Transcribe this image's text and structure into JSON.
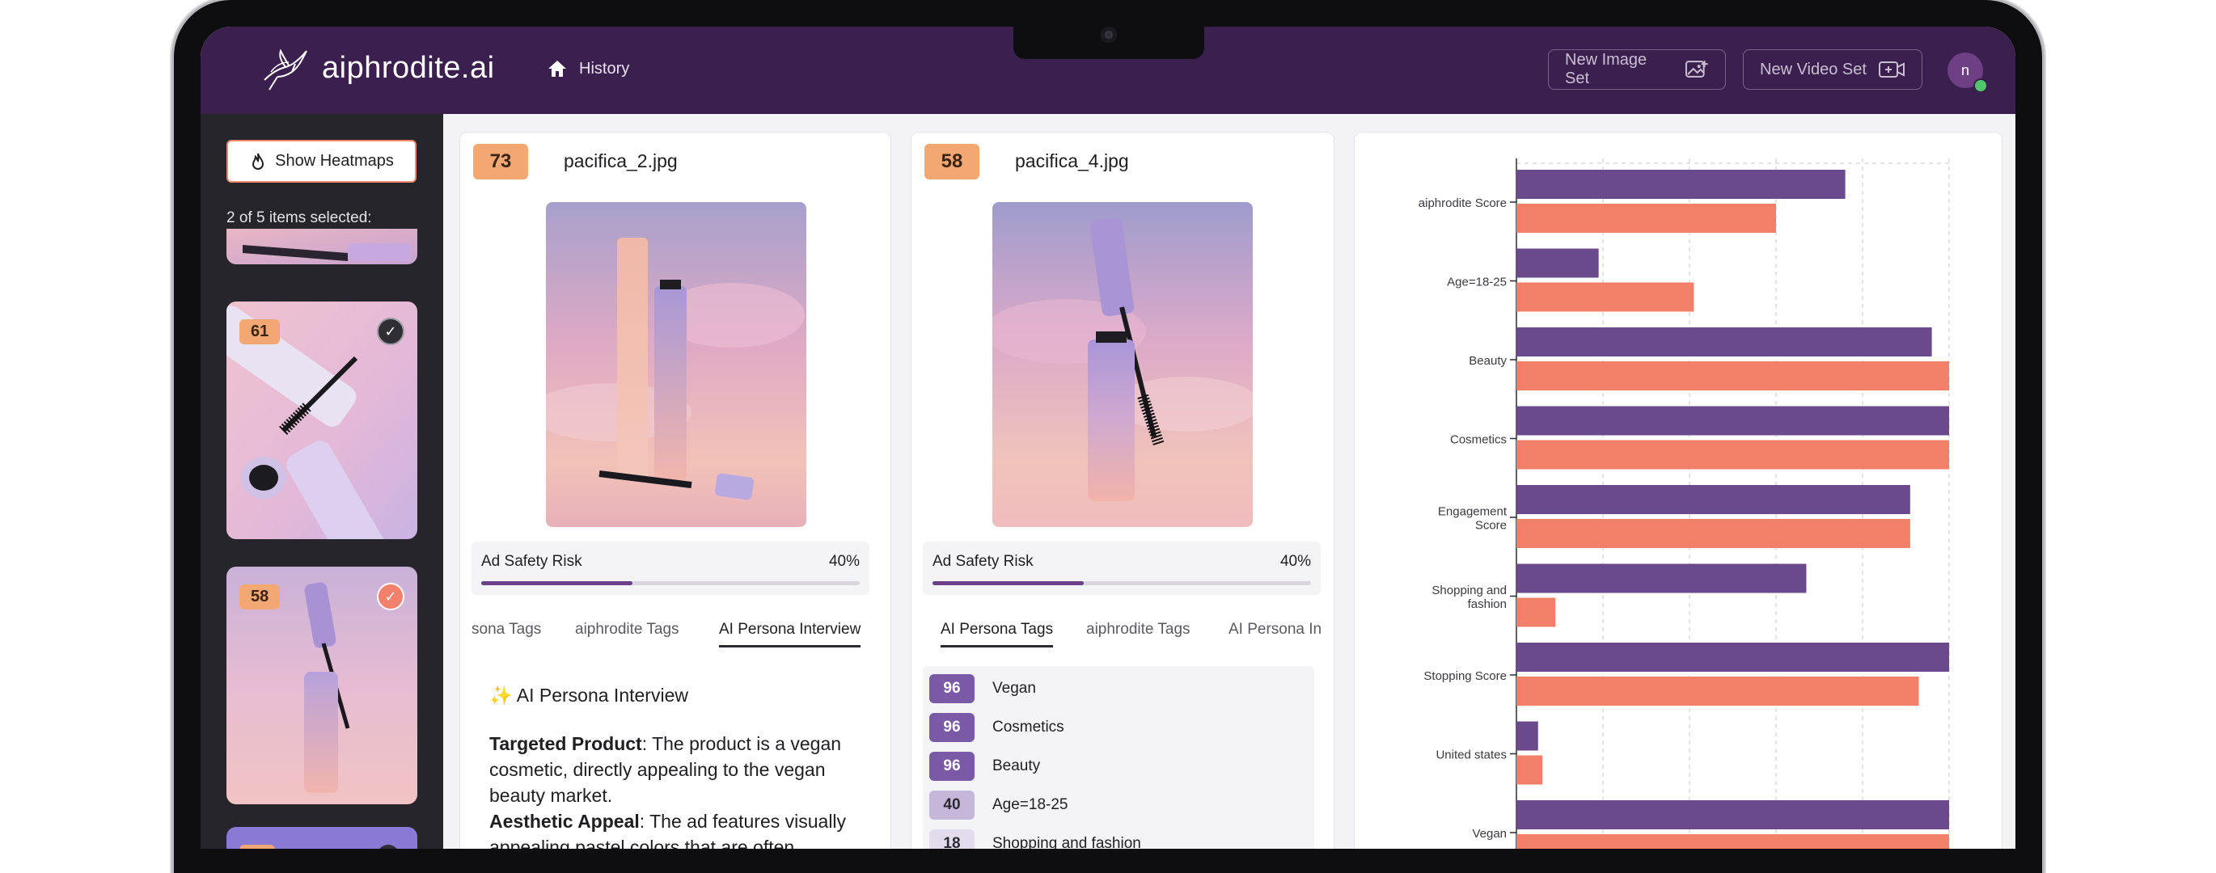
{
  "header": {
    "brand": "aiphrodite.ai",
    "nav_history": "History",
    "new_image_set": "New Image Set",
    "new_video_set": "New Video Set",
    "avatar_initial": "n"
  },
  "sidebar": {
    "heatmaps_button": "Show Heatmaps",
    "selected_count": "2 of 5 items selected:",
    "thumbnails": [
      {
        "score": "",
        "selected": false
      },
      {
        "score": "61",
        "selected": false
      },
      {
        "score": "58",
        "selected": true
      },
      {
        "score": "",
        "selected": false
      }
    ]
  },
  "cards": [
    {
      "score": "73",
      "filename": "pacifica_2.jpg",
      "ad_safety_label": "Ad Safety Risk",
      "ad_safety_value": "40%",
      "ad_safety_fraction": 0.4,
      "tabs": [
        "sona Tags",
        "aiphrodite Tags",
        "AI Persona Interview"
      ],
      "active_tab": 2,
      "interview": {
        "heading": "✨ AI Persona Interview",
        "p1_label": "Targeted Product",
        "p1_text": ": The product is a vegan cosmetic, directly appealing to the vegan beauty market.",
        "p2_label": "Aesthetic Appeal",
        "p2_text": ": The ad features visually appealing pastel colors that are often popular"
      }
    },
    {
      "score": "58",
      "filename": "pacifica_4.jpg",
      "ad_safety_label": "Ad Safety Risk",
      "ad_safety_value": "40%",
      "ad_safety_fraction": 0.4,
      "tabs": [
        "AI Persona Tags",
        "aiphrodite Tags",
        "AI Persona In"
      ],
      "active_tab": 0,
      "tags": [
        {
          "value": "96",
          "label": "Vegan"
        },
        {
          "value": "96",
          "label": "Cosmetics"
        },
        {
          "value": "96",
          "label": "Beauty"
        },
        {
          "value": "40",
          "label": "Age=18-25"
        },
        {
          "value": "18",
          "label": "Shopping and fashion"
        }
      ]
    }
  ],
  "colors": {
    "purple": "#6a4a8c",
    "coral": "#f28069",
    "score_badge": "#f3a873",
    "header": "#3b1f4f"
  },
  "chart_data": {
    "type": "bar",
    "orientation": "horizontal",
    "categories": [
      "aiphrodite Score",
      "Age=18-25",
      "Beauty",
      "Cosmetics",
      "Engagement Score",
      "Shopping and fashion",
      "Stopping Score",
      "United states",
      "Vegan"
    ],
    "category_lines": [
      [
        "aiphrodite Score"
      ],
      [
        "Age=18-25"
      ],
      [
        "Beauty"
      ],
      [
        "Cosmetics"
      ],
      [
        "Engagement",
        "Score"
      ],
      [
        "Shopping and",
        "fashion"
      ],
      [
        "Stopping Score"
      ],
      [
        "United states"
      ],
      [
        "Vegan"
      ]
    ],
    "series": [
      {
        "values": [
          76,
          19,
          96,
          100,
          91,
          67,
          100,
          5,
          100
        ],
        "color": "#6a4a8c"
      },
      {
        "values": [
          60,
          41,
          100,
          100,
          91,
          9,
          93,
          6,
          100
        ],
        "color": "#f28069"
      }
    ],
    "xlim": [
      0,
      100
    ],
    "grid": true
  }
}
